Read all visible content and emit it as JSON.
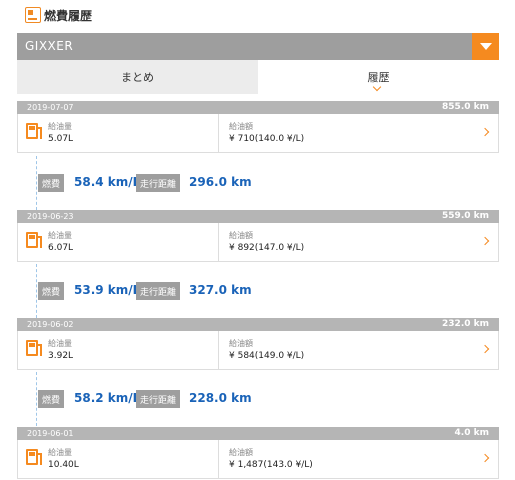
{
  "header": {
    "title": "燃費履歴",
    "icon": "fuel-log-icon"
  },
  "bike": {
    "name": "GIXXER",
    "dropdown_icon": "dropdown-triangle-icon"
  },
  "tabs": [
    {
      "label": "まとめ",
      "active": false
    },
    {
      "label": "履歴",
      "active": true
    }
  ],
  "labels": {
    "quantity": "給油量",
    "amount": "給油額",
    "efficiency": "燃費",
    "distance": "走行距離"
  },
  "entries": [
    {
      "date": "2019-07-07",
      "odometer": "855.0 km",
      "quantity": "5.07L",
      "amount": "¥ 710(140.0 ¥/L)"
    },
    {
      "date": "2019-06-23",
      "odometer": "559.0 km",
      "quantity": "6.07L",
      "amount": "¥ 892(147.0 ¥/L)"
    },
    {
      "date": "2019-06-02",
      "odometer": "232.0 km",
      "quantity": "3.92L",
      "amount": "¥ 584(149.0 ¥/L)"
    },
    {
      "date": "2019-06-01",
      "odometer": "4.0 km",
      "quantity": "10.40L",
      "amount": "¥ 1,487(143.0 ¥/L)"
    }
  ],
  "stats": [
    {
      "efficiency": "58.4 km/L",
      "distance": "296.0 km"
    },
    {
      "efficiency": "53.9 km/L",
      "distance": "327.0 km"
    },
    {
      "efficiency": "58.2 km/L",
      "distance": "228.0 km"
    }
  ],
  "colors": {
    "accent": "#f58a1f",
    "value_blue": "#1a63b8",
    "bar_gray": "#9e9e9e"
  }
}
